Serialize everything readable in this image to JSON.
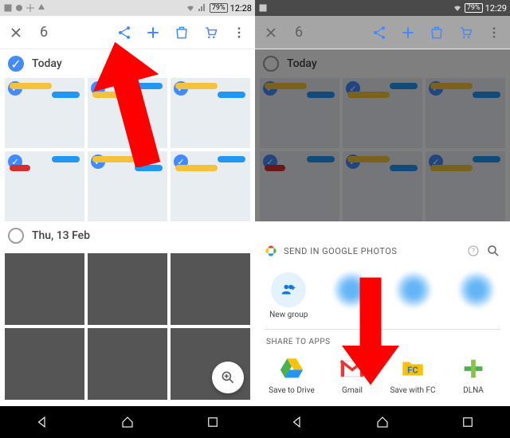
{
  "statusbar": {
    "battery": "79%",
    "time_left": "12:28",
    "time_right": "12:29"
  },
  "toolbar": {
    "count": "6"
  },
  "sections": {
    "today": "Today",
    "thu": "Thu, 13 Feb"
  },
  "sheet": {
    "title": "SEND IN GOOGLE PHOTOS",
    "new_group": "New group",
    "share_title": "SHARE TO APPS",
    "apps": {
      "drive": "Save to Drive",
      "gmail": "Gmail",
      "fc": "Save with FC",
      "dlna": "DLNA"
    }
  }
}
